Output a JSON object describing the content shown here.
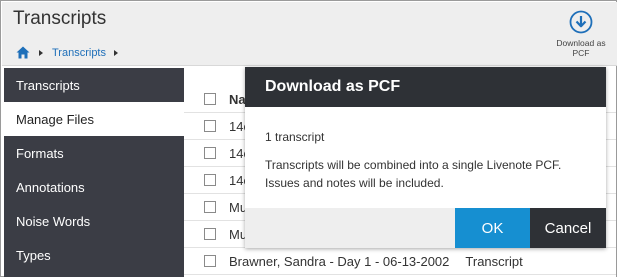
{
  "app": {
    "title": "Transcripts"
  },
  "breadcrumb": {
    "items": [
      "Transcripts"
    ]
  },
  "toolbar": {
    "download_label": "Download as PCF"
  },
  "sidebar": {
    "items": [
      {
        "label": "Transcripts"
      },
      {
        "label": "Manage Files",
        "active": true
      },
      {
        "label": "Formats"
      },
      {
        "label": "Annotations"
      },
      {
        "label": "Noise Words"
      },
      {
        "label": "Types"
      }
    ]
  },
  "list": {
    "header": "Na",
    "rows": [
      {
        "name": "14c",
        "type": ""
      },
      {
        "name": "14c",
        "type": ""
      },
      {
        "name": "14c",
        "type": ""
      },
      {
        "name": "Mu",
        "type": ""
      },
      {
        "name": "Mu",
        "type": ""
      },
      {
        "name": "Brawner, Sandra - Day 1 - 06-13-2002",
        "type": "Transcript"
      }
    ]
  },
  "dialog": {
    "title": "Download as PCF",
    "count_text": "1 transcript",
    "message": "Transcripts will be combined into a single Livenote PCF. Issues and notes will be included.",
    "ok_label": "OK",
    "cancel_label": "Cancel"
  },
  "colors": {
    "accent": "#168fd1",
    "sidebar_bg": "#3b3d45",
    "dialog_header_bg": "#2e3136",
    "link": "#1e6fb9"
  },
  "icons": {
    "home": "home-icon",
    "download": "download-circle-icon"
  }
}
